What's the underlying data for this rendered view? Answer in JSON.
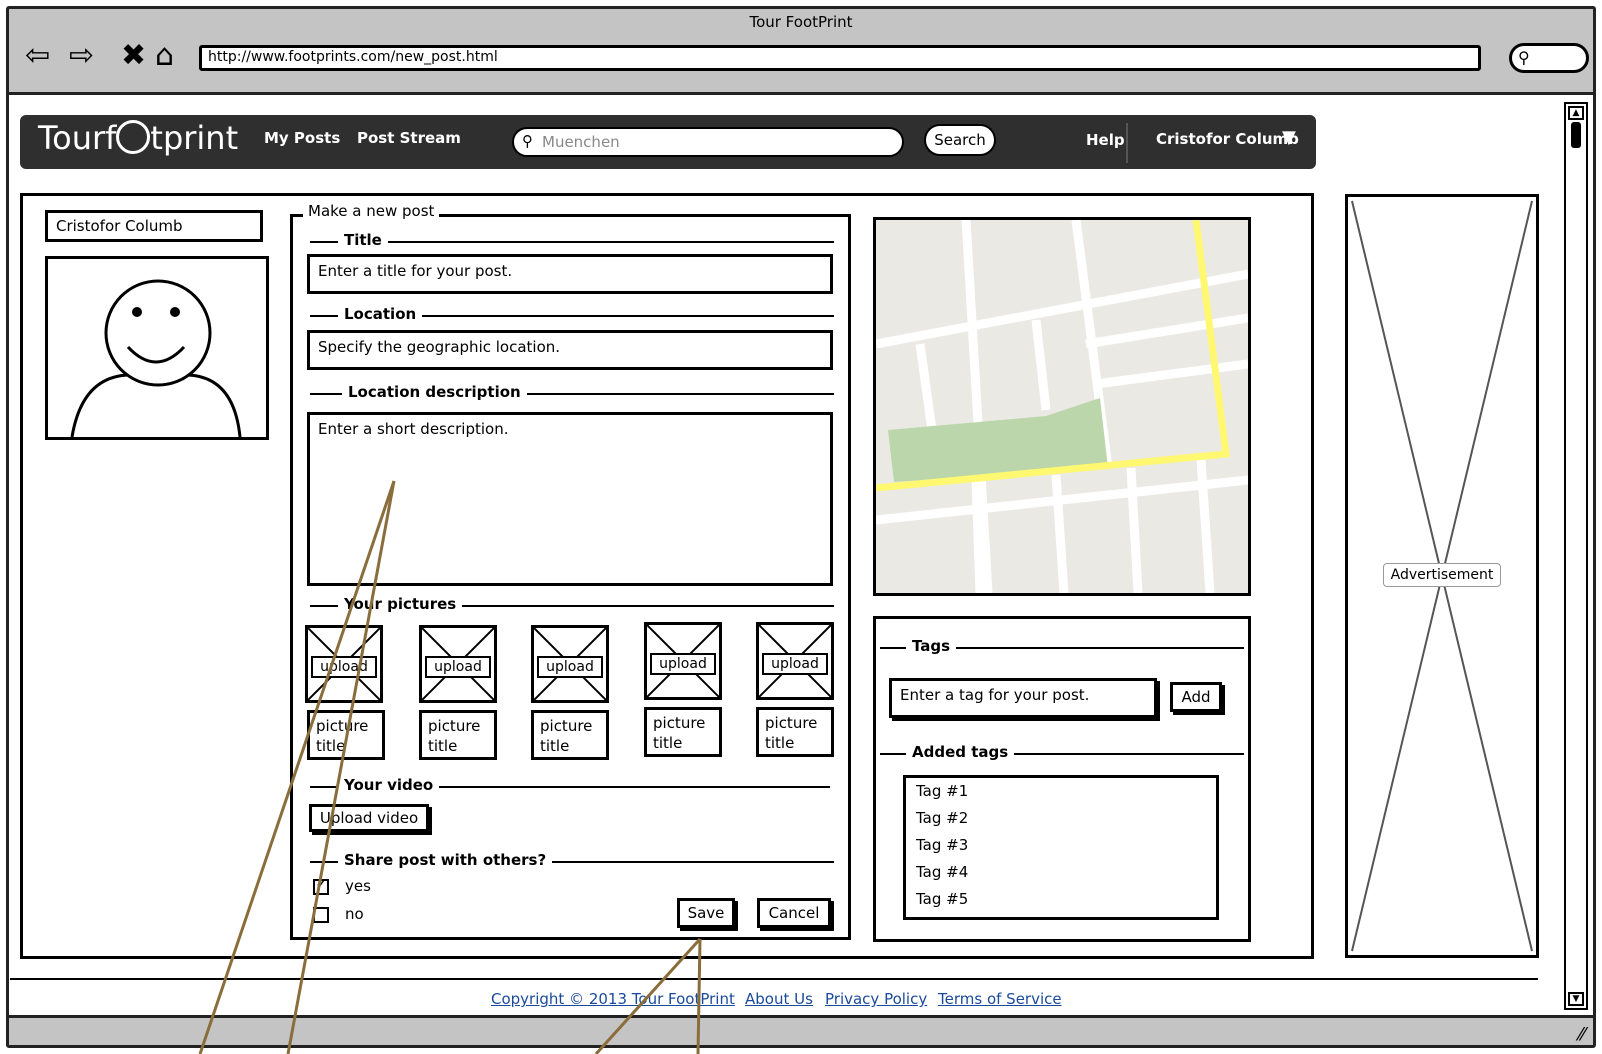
{
  "browser": {
    "title": "Tour FootPrint",
    "url": "http://www.footprints.com/new_post.html",
    "nav_icons": [
      "back-arrow-icon",
      "forward-arrow-icon",
      "stop-icon",
      "home-icon"
    ]
  },
  "topnav": {
    "logo_prefix": "Tourf",
    "logo_suffix": "tprint",
    "links": [
      "My Posts",
      "Post Stream"
    ],
    "search_placeholder": "Muenchen",
    "search_button": "Search",
    "help": "Help",
    "user": "Cristofor Columb"
  },
  "profile": {
    "name": "Cristofor Columb"
  },
  "form": {
    "legend": "Make a new post",
    "title_section": "Title",
    "title_placeholder": "Enter a title for your post.",
    "location_section": "Location",
    "location_placeholder": "Specify the geographic location.",
    "location_desc_section": "Location description",
    "location_desc_placeholder": "Enter a short description.",
    "pictures_section": "Your pictures",
    "upload_label": "upload",
    "picture_title_line1": "picture",
    "picture_title_line2": "title",
    "video_section": "Your video",
    "upload_video": "Upload video",
    "share_section": "Share post with others?",
    "share_options": [
      {
        "label": "yes",
        "checked": true
      },
      {
        "label": "no",
        "checked": false
      }
    ],
    "save": "Save",
    "cancel": "Cancel"
  },
  "tags": {
    "section": "Tags",
    "input_placeholder": "Enter a tag for your post.",
    "add_button": "Add",
    "added_section": "Added tags",
    "items": [
      "Tag #1",
      "Tag #2",
      "Tag #3",
      "Tag #4",
      "Tag #5"
    ]
  },
  "ad": {
    "label": "Advertisement"
  },
  "footer": {
    "links": [
      "Copyright © 2013 Tour FootPrint",
      "About Us",
      "Privacy Policy",
      "Terms of Service"
    ]
  },
  "colors": {
    "chrome": "#c4c4c4",
    "navbar": "#2f2f2f",
    "link": "#1a4a9c",
    "map_bg": "#ebe9e4",
    "map_park": "#bcd6ac",
    "map_road": "#fff870",
    "callout": "#8a6d3b"
  }
}
